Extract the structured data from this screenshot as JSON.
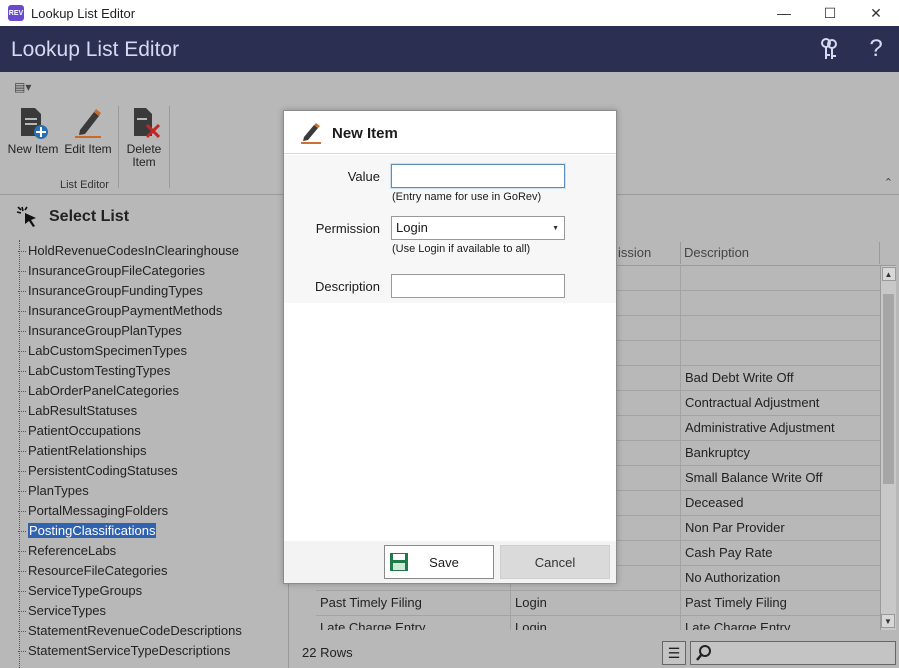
{
  "window": {
    "title": "Lookup List Editor",
    "app_icon_text": "REV",
    "minimize": "—",
    "maximize": "☐",
    "close": "✕"
  },
  "header": {
    "title": "Lookup List Editor",
    "keys_icon": "keys-icon",
    "help_glyph": "?"
  },
  "ribbon": {
    "quick_access_glyph": "▤▾",
    "buttons": [
      {
        "label": "New Item",
        "icon": "new-item-icon"
      },
      {
        "label": "Edit Item",
        "icon": "edit-item-icon"
      },
      {
        "label": "Delete Item",
        "icon": "delete-item-icon"
      }
    ],
    "group_label": "List Editor",
    "collapse_glyph": "⌃"
  },
  "select_list": {
    "label": "Select List",
    "icon": "cursor-click-icon"
  },
  "tree": {
    "items": [
      "HoldRevenueCodesInClearinghouse",
      "InsuranceGroupFileCategories",
      "InsuranceGroupFundingTypes",
      "InsuranceGroupPaymentMethods",
      "InsuranceGroupPlanTypes",
      "LabCustomSpecimenTypes",
      "LabCustomTestingTypes",
      "LabOrderPanelCategories",
      "LabResultStatuses",
      "PatientOccupations",
      "PatientRelationships",
      "PersistentCodingStatuses",
      "PlanTypes",
      "PortalMessagingFolders",
      "PostingClassifications",
      "ReferenceLabs",
      "ResourceFileCategories",
      "ServiceTypeGroups",
      "ServiceTypes",
      "StatementRevenueCodeDescriptions",
      "StatementServiceTypeDescriptions"
    ],
    "selected": "PostingClassifications"
  },
  "grid": {
    "columns": {
      "permission_partial": "ission",
      "description": "Description"
    },
    "rows": [
      {
        "value": "",
        "permission": "",
        "description": ""
      },
      {
        "value": "",
        "permission": "",
        "description": ""
      },
      {
        "value": "",
        "permission": "",
        "description": ""
      },
      {
        "value": "",
        "permission": "",
        "description": ""
      },
      {
        "value": "",
        "permission": "",
        "description": "Bad Debt Write Off"
      },
      {
        "value": "",
        "permission": "",
        "description": "Contractual Adjustment"
      },
      {
        "value": "",
        "permission": "",
        "description": "Administrative Adjustment"
      },
      {
        "value": "",
        "permission": "",
        "description": "Bankruptcy"
      },
      {
        "value": "",
        "permission": "",
        "description": "Small Balance Write Off"
      },
      {
        "value": "",
        "permission": "",
        "description": "Deceased"
      },
      {
        "value": "",
        "permission": "",
        "description": "Non Par Provider"
      },
      {
        "value": "",
        "permission": "",
        "description": "Cash Pay Rate"
      },
      {
        "value": "",
        "permission": "",
        "description": "No Authorization"
      },
      {
        "value": "Past Timely Filing",
        "permission": "Login",
        "description": "Past Timely Filing"
      },
      {
        "value": "Late Charge Entry",
        "permission": "Login",
        "description": "Late Charge Entry"
      }
    ],
    "row_count": "22 Rows",
    "scroll_up": "▲",
    "scroll_down": "▼",
    "menu_glyph": "☰"
  },
  "modal": {
    "title": "New Item",
    "value_label": "Value",
    "value_text": "",
    "value_hint": "(Entry name for use in GoRev)",
    "permission_label": "Permission",
    "permission_selected": "Login",
    "permission_hint": "(Use Login if available to all)",
    "description_label": "Description",
    "description_text": "",
    "save_label": "Save",
    "cancel_label": "Cancel",
    "caret": "▼"
  }
}
